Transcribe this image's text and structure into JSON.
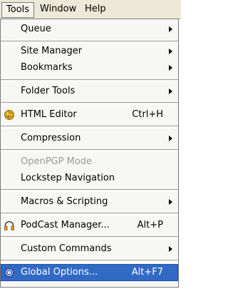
{
  "menubar": {
    "tools": "Tools",
    "window": "Window",
    "help": "Help"
  },
  "menu": {
    "queue": "Queue",
    "site_manager": "Site Manager",
    "bookmarks": "Bookmarks",
    "folder_tools": "Folder Tools",
    "html_editor": "HTML Editor",
    "html_editor_shortcut": "Ctrl+H",
    "compression": "Compression",
    "openpgp_mode": "OpenPGP Mode",
    "lockstep_navigation": "Lockstep Navigation",
    "macros_scripting": "Macros & Scripting",
    "podcast_manager": "PodCast Manager...",
    "podcast_manager_shortcut": "Alt+P",
    "custom_commands": "Custom Commands",
    "global_options": "Global Options...",
    "global_options_shortcut": "Alt+F7"
  },
  "colors": {
    "highlight": "#316ac5",
    "disabled_text": "#9a9a9a",
    "menubar_bg": "#ece9d8"
  },
  "icons": {
    "html_editor": "html-editor-globe-icon",
    "podcast_manager": "podcast-headphones-icon",
    "global_options": "global-options-gear-icon"
  }
}
